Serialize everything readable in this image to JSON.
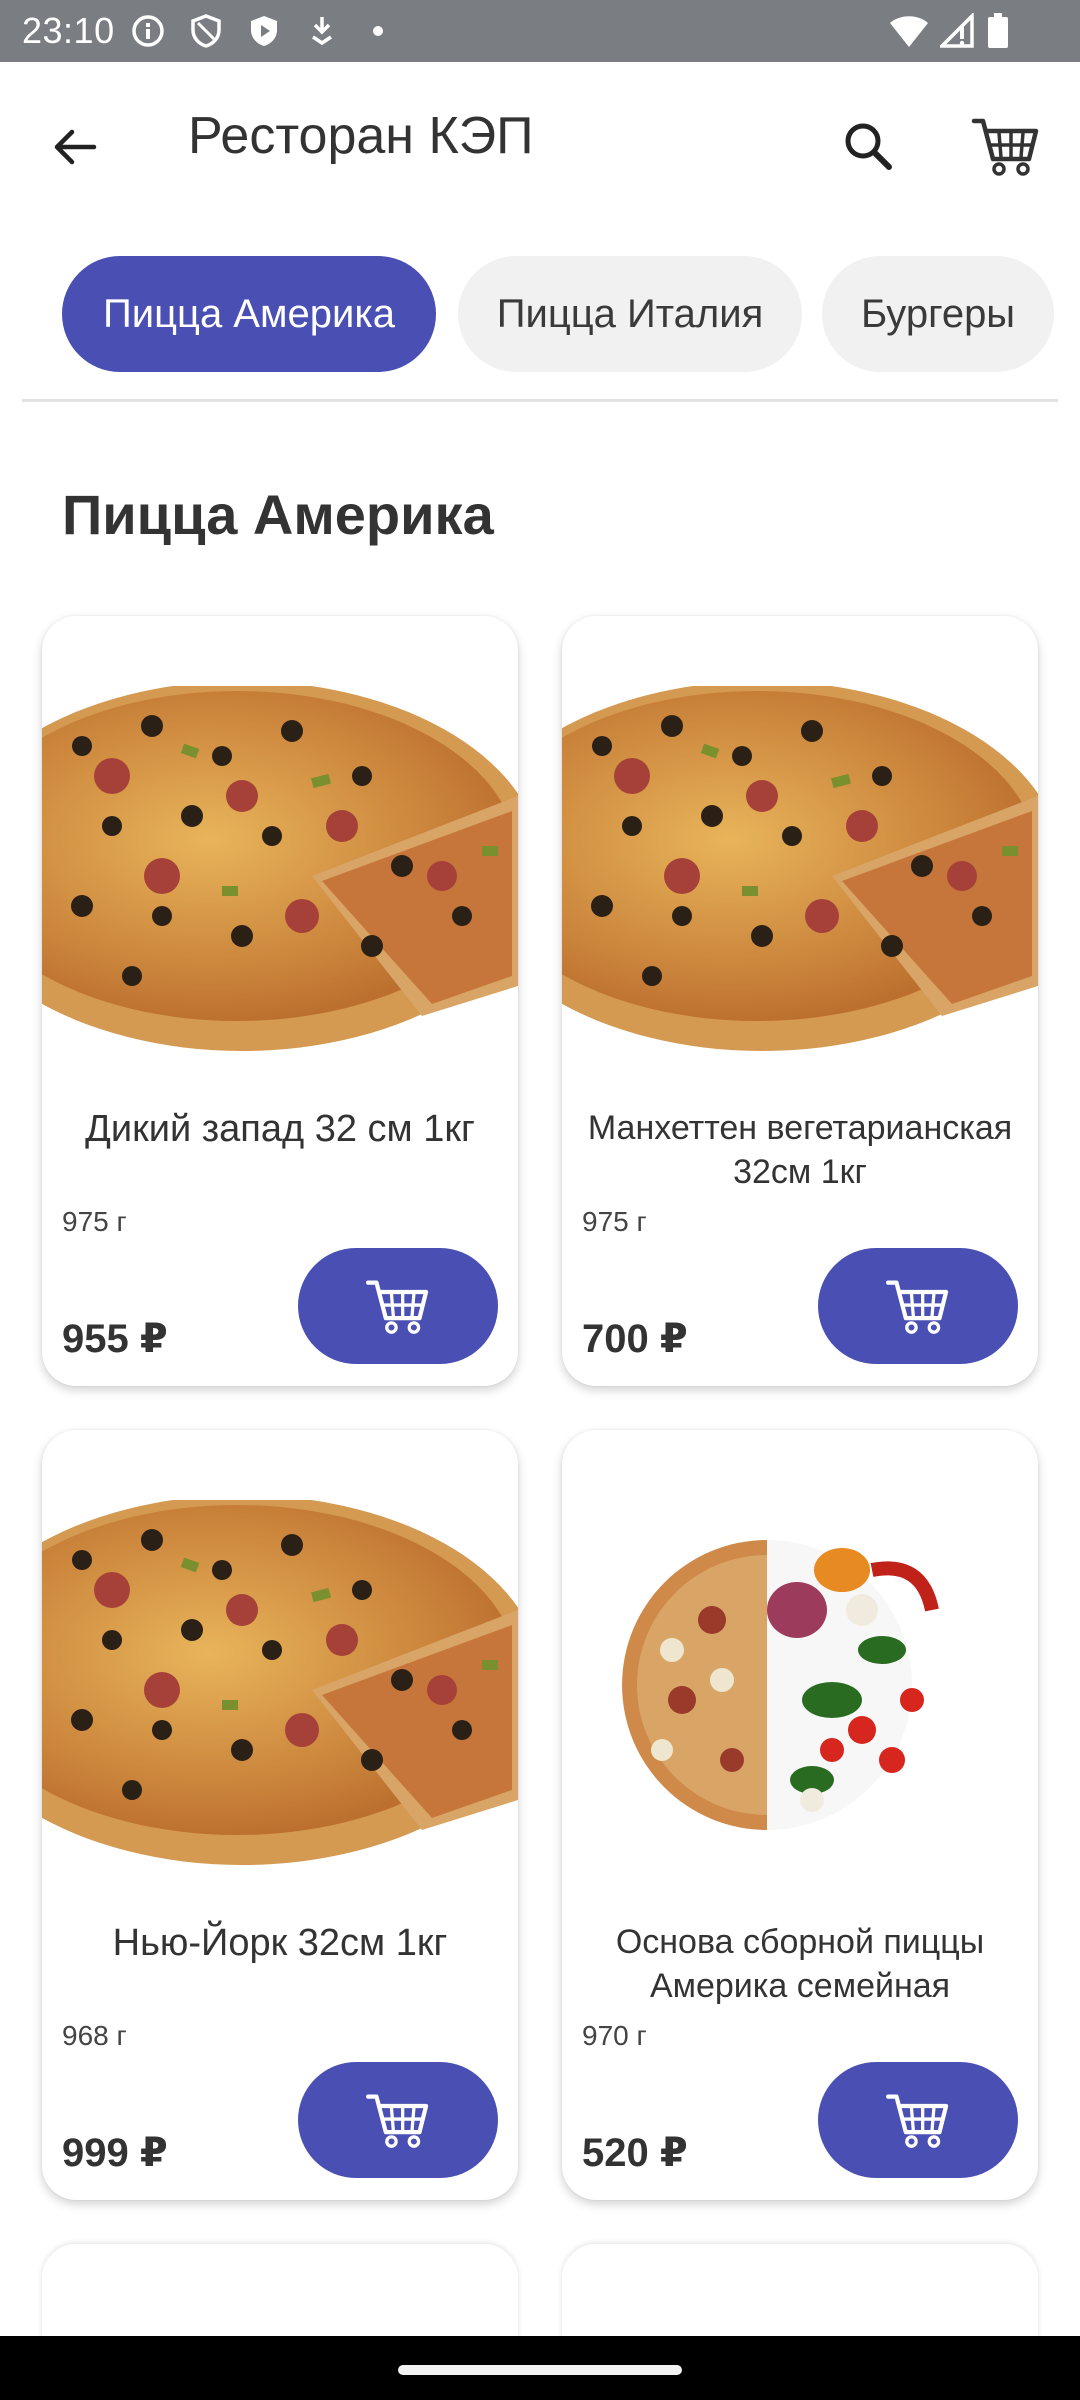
{
  "status_bar": {
    "time": "23:10",
    "icons": [
      "info-circle-icon",
      "shield-icon",
      "play-shield-icon",
      "download-icon",
      "dot-icon",
      "wifi-icon",
      "signal-icon",
      "battery-icon"
    ]
  },
  "app_bar": {
    "title": "Ресторан КЭП",
    "icons": [
      "arrow-back-icon",
      "search-icon",
      "shopping-cart-icon"
    ]
  },
  "tabs": [
    {
      "label": "Пицца Америка",
      "active": true
    },
    {
      "label": "Пицца Италия",
      "active": false
    },
    {
      "label": "Бургеры",
      "active": false
    }
  ],
  "section": {
    "title": "Пицца Америка"
  },
  "products": [
    {
      "name": "Дикий запад 32 см 1кг",
      "weight": "975 г",
      "price": "955 ₽",
      "image": "pizza-slice-image"
    },
    {
      "name": "Манхеттен вегетарианская 32см 1кг",
      "weight": "975 г",
      "price": "700 ₽",
      "image": "pizza-slice-image"
    },
    {
      "name": "Нью-Йорк 32см 1кг",
      "weight": "968 г",
      "price": "999 ₽",
      "image": "pizza-slice-image"
    },
    {
      "name": "Основа сборной пиццы Америка семейная",
      "weight": "970 г",
      "price": "520 ₽",
      "image": "half-pizza-half-vegetables-image"
    }
  ],
  "colors": {
    "accent": "#4a4fb3",
    "status_bar": "#7a7d82",
    "tab_inactive": "#f1f1f1"
  }
}
